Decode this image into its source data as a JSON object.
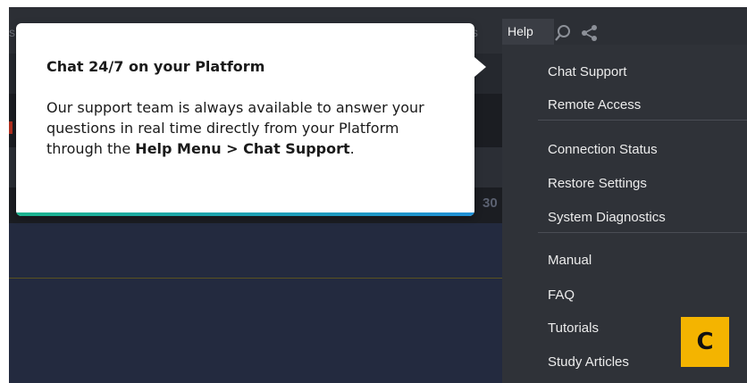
{
  "menubar": {
    "left_fragment": "s",
    "right_fragment": "ts",
    "help_label": "Help",
    "icons": {
      "search": "search-icon",
      "share": "share-icon"
    }
  },
  "background": {
    "partial_number": "30"
  },
  "popup": {
    "title": "Chat 24/7 on your Platform",
    "body_text": "Our support team is always available to answer your questions in real time directly from your Platform through the ",
    "body_bold": "Help Menu > Chat Support",
    "body_end": "."
  },
  "help_menu": {
    "items": [
      "Chat Support",
      "Remote Access",
      "Connection Status",
      "Restore Settings",
      "System Diagnostics",
      "Manual",
      "FAQ",
      "Tutorials",
      "Study Articles"
    ]
  },
  "badge": {
    "label": "C"
  },
  "colors": {
    "accent_start": "#1bb38e",
    "accent_end": "#1f8fd6",
    "badge": "#f4b400",
    "app_bg": "#20232a"
  }
}
